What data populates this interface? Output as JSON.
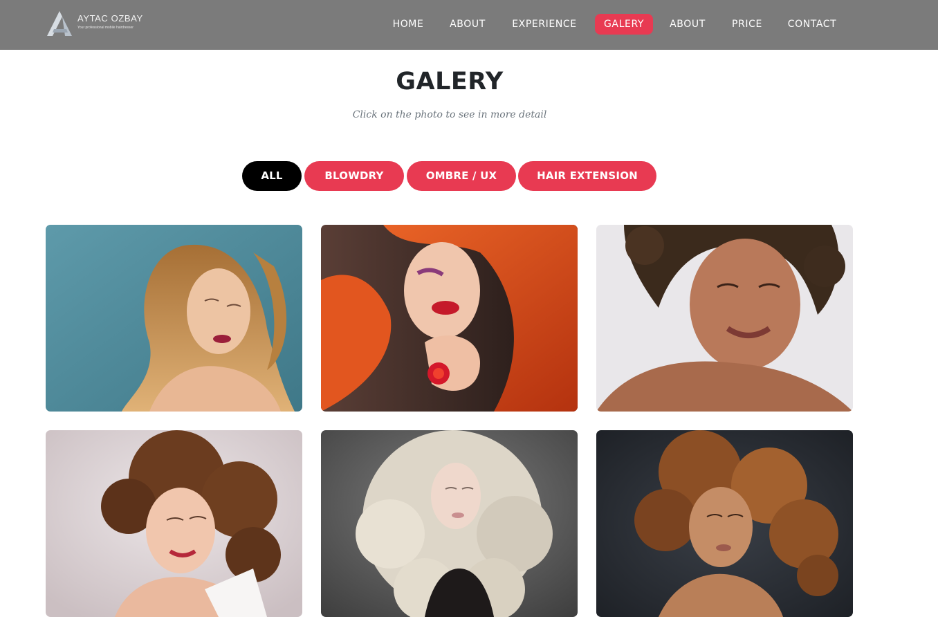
{
  "header": {
    "brand": {
      "name": "AYTAC OZBAY",
      "tagline": "Your professional mobile hairdresser"
    },
    "nav": [
      {
        "label": "HOME",
        "active": false
      },
      {
        "label": "ABOUT",
        "active": false
      },
      {
        "label": "EXPERIENCE",
        "active": false
      },
      {
        "label": "GALERY",
        "active": true
      },
      {
        "label": "ABOUT",
        "active": false
      },
      {
        "label": "PRICE",
        "active": false
      },
      {
        "label": "CONTACT",
        "active": false
      }
    ]
  },
  "gallery": {
    "title": "GALERY",
    "subtitle": "Click on the photo to see in more detail",
    "filters": [
      {
        "label": "ALL",
        "active": true
      },
      {
        "label": "BLOWDRY",
        "active": false
      },
      {
        "label": "OMBRE / UX",
        "active": false
      },
      {
        "label": "HAIR EXTENSION",
        "active": false
      }
    ],
    "photos": [
      {
        "subject": "woman with long wavy blonde hair",
        "background": "#4e8c9c",
        "hair": "#c58a4a"
      },
      {
        "subject": "woman with long red hair and red ring",
        "background": "#3a2b28",
        "hair": "#e0521c"
      },
      {
        "subject": "smiling woman with dark curly hair",
        "background": "#e7e5e6",
        "hair": "#3b2a1c"
      },
      {
        "subject": "woman with voluminous brown curls",
        "background": "#d8cfd1",
        "hair": "#6a3b1e"
      },
      {
        "subject": "woman with platinum blonde curls",
        "background": "#5a5a5a",
        "hair": "#e6e0d6"
      },
      {
        "subject": "woman with big auburn curly hair",
        "background": "#262a31",
        "hair": "#9a5a2c"
      }
    ]
  },
  "colors": {
    "header_bg": "#7b7b7b",
    "accent": "#e83a52",
    "active_filter": "#000000",
    "title": "#212529",
    "subtitle": "#6c757d"
  }
}
